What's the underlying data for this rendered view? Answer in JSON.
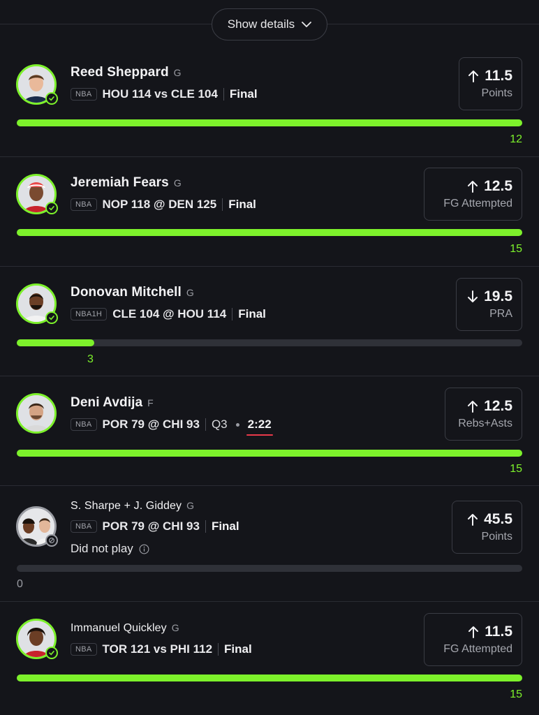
{
  "header": {
    "show_details_label": "Show details"
  },
  "picks": [
    {
      "name": "Reed Sheppard",
      "position": "G",
      "league": "NBA",
      "matchup": "HOU 114 vs CLE 104",
      "status": "Final",
      "direction": "up",
      "line": "11.5",
      "stat": "Points",
      "result": "12",
      "progress": 1.0,
      "badge": "check-icon"
    },
    {
      "name": "Jeremiah Fears",
      "position": "G",
      "league": "NBA",
      "matchup": "NOP 118 @ DEN 125",
      "status": "Final",
      "direction": "up",
      "line": "12.5",
      "stat": "FG Attempted",
      "result": "15",
      "progress": 1.0,
      "badge": "check-icon"
    },
    {
      "name": "Donovan Mitchell",
      "position": "G",
      "league": "NBA1H",
      "matchup": "CLE 104 @ HOU 114",
      "status": "Final",
      "direction": "down",
      "line": "19.5",
      "stat": "PRA",
      "result": "3",
      "progress": 0.154,
      "badge": "check-icon"
    },
    {
      "name": "Deni Avdija",
      "position": "F",
      "league": "NBA",
      "matchup": "POR 79 @ CHI 93",
      "status_period": "Q3",
      "status_clock": "2:22",
      "direction": "up",
      "line": "12.5",
      "stat": "Rebs+Asts",
      "result": "15",
      "progress": 1.0,
      "badge": "check-icon"
    },
    {
      "name": "S. Sharpe + J. Giddey",
      "position": "G",
      "league": "NBA",
      "matchup": "POR 79 @ CHI 93",
      "status": "Final",
      "note": "Did not play",
      "direction": "up",
      "line": "45.5",
      "stat": "Points",
      "result": "0",
      "progress": 0.0,
      "badge": "blocked-icon"
    },
    {
      "name": "Immanuel Quickley",
      "position": "G",
      "league": "NBA",
      "matchup": "TOR 121 vs PHI 112",
      "status": "Final",
      "direction": "up",
      "line": "11.5",
      "stat": "FG Attempted",
      "result": "15",
      "progress": 1.0,
      "badge": "check-icon"
    }
  ],
  "colors": {
    "accent": "#7df12b",
    "background": "#14151a",
    "live_underline": "#e8394a"
  }
}
